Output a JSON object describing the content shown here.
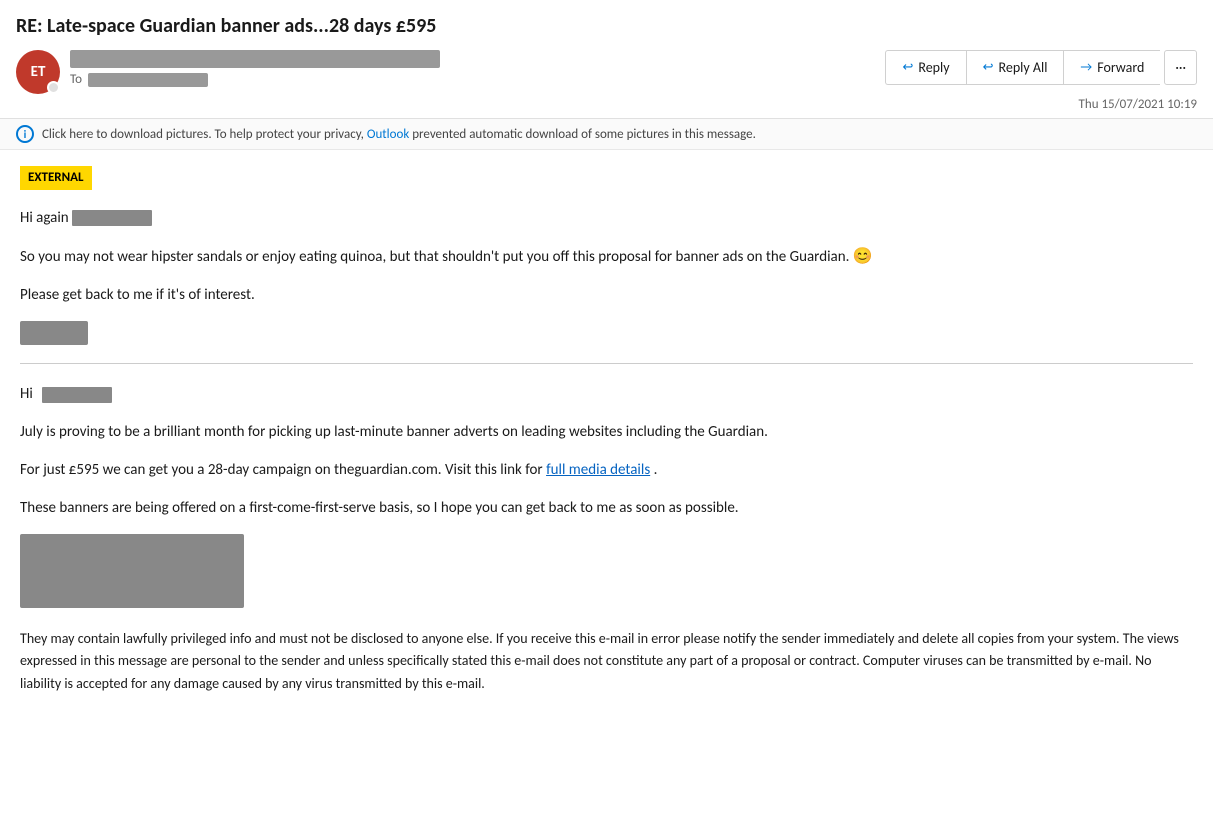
{
  "subject": "RE: Late-space Guardian banner ads...28 days £595",
  "sender": {
    "initials": "ET",
    "avatar_color": "#c0392b"
  },
  "to_label": "To",
  "date": "Thu 15/07/2021 10:19",
  "buttons": {
    "reply": "Reply",
    "reply_all": "Reply All",
    "forward": "Forward",
    "more_symbol": "···"
  },
  "download_bar": {
    "text_before": "Click here to download pictures. To help protect your privacy,",
    "outlook_text": "Outlook",
    "text_after": "prevented automatic download of some pictures in this message."
  },
  "body": {
    "external_label": "EXTERNAL",
    "greeting1": "Hi again",
    "paragraph1": "So you may not wear hipster sandals or enjoy eating quinoa, but that shouldn't put you off this proposal for banner ads on the Guardian.",
    "paragraph2": "Please get back to me if it's of interest.",
    "greeting2": "Hi",
    "paragraph3": "July is proving to be a brilliant month for picking up last-minute banner adverts on leading websites including the Guardian.",
    "paragraph4_before": "For just £595 we can get you a 28-day campaign on theguardian.com. Visit this link for",
    "paragraph4_link": "full media details",
    "paragraph4_after": ".",
    "paragraph5": "These banners are being offered on a first-come-first-serve basis, so I hope you can get back to me as soon as possible.",
    "disclaimer": "They may contain lawfully privileged info and must not be disclosed to anyone else. If you receive this e-mail in error please notify the sender immediately and delete all copies from your system. The views expressed in this message are personal to the sender and unless specifically stated this e-mail does not constitute any part of a proposal or contract. Computer viruses can be transmitted by e-mail.  No liability is accepted for any damage caused by any virus transmitted by this e-mail."
  }
}
